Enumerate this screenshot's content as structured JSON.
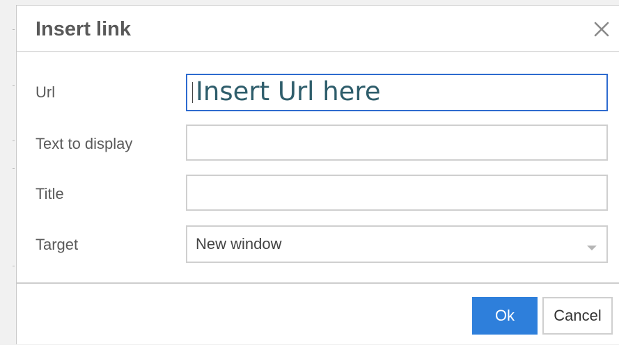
{
  "dialog": {
    "title": "Insert link",
    "close_icon": "close-icon"
  },
  "fields": {
    "url": {
      "label": "Url",
      "value": "Insert Url here"
    },
    "text_to_display": {
      "label": "Text to display",
      "value": ""
    },
    "title": {
      "label": "Title",
      "value": ""
    },
    "target": {
      "label": "Target",
      "selected": "New window",
      "arrow_icon": "chevron-down-icon"
    }
  },
  "buttons": {
    "ok_label": "Ok",
    "cancel_label": "Cancel"
  },
  "colors": {
    "primary": "#2e7fdb",
    "focus_border": "#2e6bcf",
    "url_text": "#2e5d6b",
    "title_text": "#595959",
    "label_text": "#5a5a5a",
    "border": "#cfcfcf"
  }
}
